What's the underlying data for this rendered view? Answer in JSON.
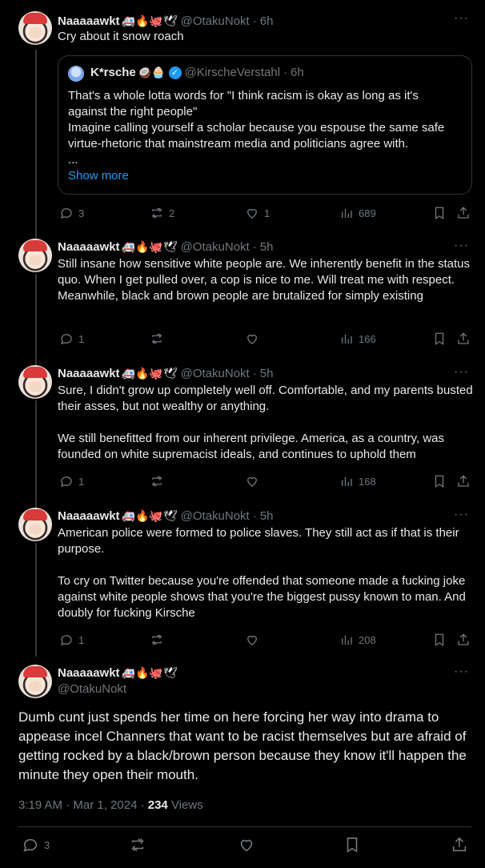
{
  "replies": [
    {
      "name": "Naaaaawkt",
      "emojis": "🚑🔥🐙🕊",
      "handle": "@OtakuNokt",
      "time": "6h",
      "text": "Cry about it snow roach",
      "quote": {
        "name": "K*rsche",
        "emojis": "🥥🧁",
        "handle": "@KirscheVerstahl",
        "time": "6h",
        "text": "That's a whole lotta words for \"I think racism is okay as long as it's against the right people\"\nImagine calling yourself a scholar because you espouse the same safe virtue-rhetoric that mainstream media and politicians agree with.\n...",
        "show_more": "Show more"
      },
      "stats": {
        "replies": "3",
        "retweets": "2",
        "likes": "1",
        "views": "689"
      }
    },
    {
      "name": "Naaaaawkt",
      "emojis": "🚑🔥🐙🕊",
      "handle": "@OtakuNokt",
      "time": "5h",
      "text": "Still insane how sensitive white people are. We inherently benefit in the status quo. When I get pulled over, a cop is nice to me. Will treat me with respect. Meanwhile, black and brown people are brutalized for simply existing",
      "stats": {
        "replies": "1",
        "retweets": "",
        "likes": "",
        "views": "166"
      }
    },
    {
      "name": "Naaaaawkt",
      "emojis": "🚑🔥🐙🕊",
      "handle": "@OtakuNokt",
      "time": "5h",
      "text": "Sure, I didn't grow up completely well off. Comfortable, and my parents busted their asses, but not wealthy or anything.\n\nWe still benefitted from our inherent privilege. America, as a country, was founded on white supremacist ideals, and continues to uphold them",
      "stats": {
        "replies": "1",
        "retweets": "",
        "likes": "",
        "views": "168"
      }
    },
    {
      "name": "Naaaaawkt",
      "emojis": "🚑🔥🐙🕊",
      "handle": "@OtakuNokt",
      "time": "5h",
      "text": "American police were formed to police slaves. They still act as if that is their purpose.\n\nTo cry on Twitter because you're offended that someone made a fucking joke against white people shows that you're the biggest pussy known to man. And doubly for fucking Kirsche",
      "stats": {
        "replies": "1",
        "retweets": "",
        "likes": "",
        "views": "208"
      }
    }
  ],
  "main": {
    "name": "Naaaaawkt",
    "emojis": "🚑🔥🐙🕊",
    "handle": "@OtakuNokt",
    "text": "Dumb cunt just spends her time on here forcing her way into drama to appease incel Channers that want to be racist themselves but are afraid of getting rocked by a black/brown person because they know it'll happen the minute they open their mouth.",
    "timestamp": "3:19 AM · Mar 1, 2024 · ",
    "views_count": "234",
    "views_label": " Views",
    "stats": {
      "replies": "3"
    }
  },
  "more_glyph": "···",
  "separator": "·",
  "colors": {
    "background": "#000000",
    "text": "#e7e9ea",
    "muted": "#71767b",
    "accent": "#1d9bf0",
    "border": "#2f3336"
  }
}
